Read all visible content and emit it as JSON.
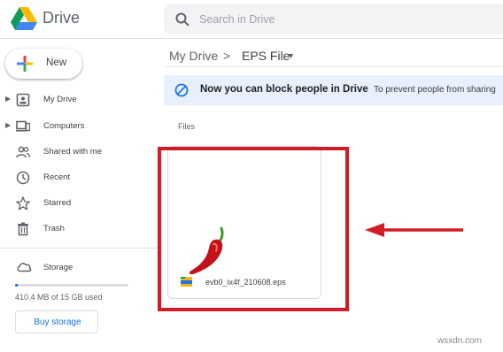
{
  "header": {
    "app_name": "Drive",
    "search_placeholder": "Search in Drive",
    "logo_icon": "google-drive-logo",
    "search_icon": "search-icon"
  },
  "sidebar": {
    "new_label": "New",
    "items": [
      {
        "label": "My Drive",
        "icon": "my-drive-icon",
        "expandable": true
      },
      {
        "label": "Computers",
        "icon": "computers-icon",
        "expandable": true
      },
      {
        "label": "Shared with me",
        "icon": "shared-icon",
        "expandable": false
      },
      {
        "label": "Recent",
        "icon": "clock-icon",
        "expandable": false
      },
      {
        "label": "Starred",
        "icon": "star-icon",
        "expandable": false
      },
      {
        "label": "Trash",
        "icon": "trash-icon",
        "expandable": false
      }
    ],
    "storage": {
      "label": "Storage",
      "usage_text": "410.4 MB of 15 GB used",
      "used_fraction": 0.027,
      "buy_label": "Buy storage"
    }
  },
  "breadcrumb": {
    "root": "My Drive",
    "separator": ">",
    "current": "EPS File"
  },
  "banner": {
    "title": "Now you can block people in Drive",
    "subtitle": "To prevent people from sharing",
    "icon": "block-icon"
  },
  "files_section": {
    "title": "Files",
    "files": [
      {
        "name": "evb0_ix4f_210608.eps",
        "thumbnail": "chili-pepper",
        "type_icon": "eps-file-icon"
      }
    ]
  },
  "annotations": {
    "highlight_color": "#d01c24",
    "arrow_color": "#d01c24"
  },
  "watermark": "wsxdn.com",
  "colors": {
    "accent": "#1a73e8",
    "banner_bg": "#e8f0fe",
    "search_bg": "#f1f3f4"
  }
}
